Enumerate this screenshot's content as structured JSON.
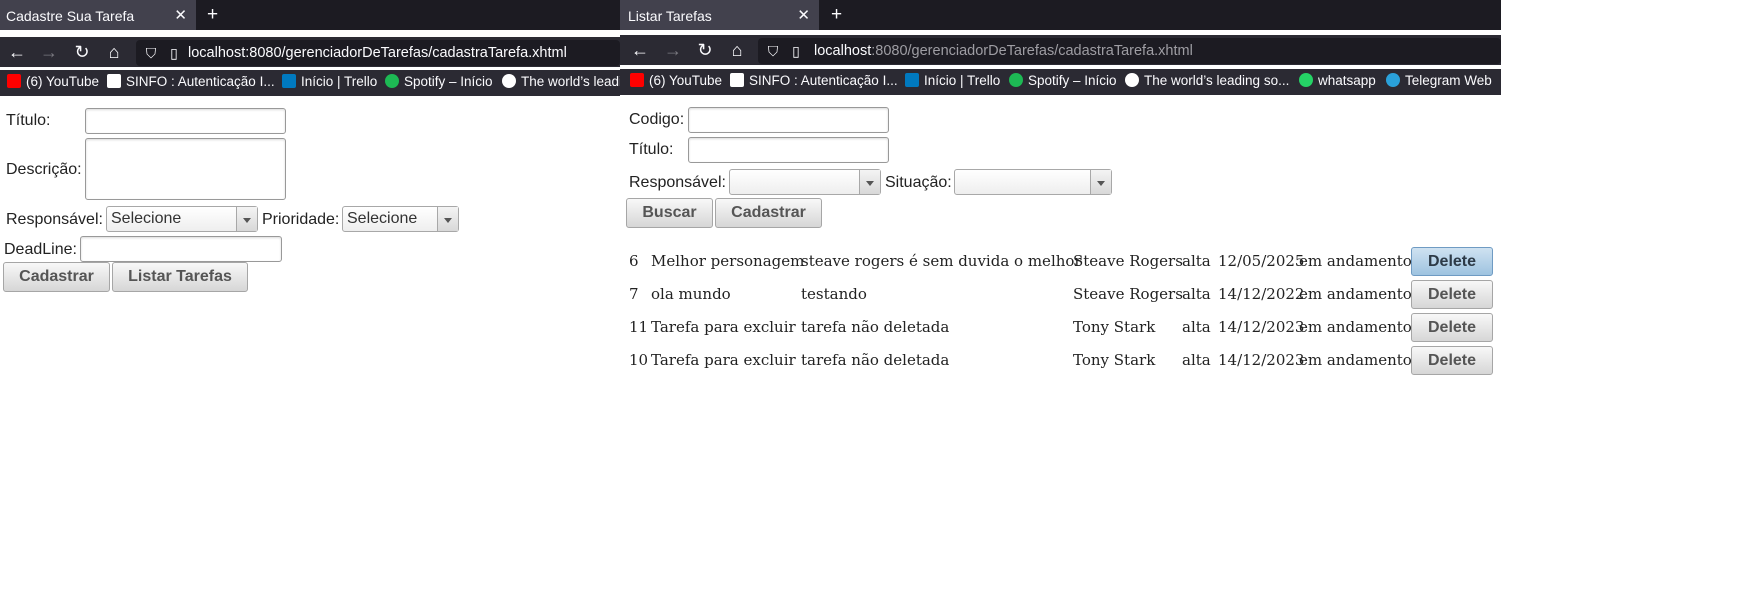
{
  "left_window": {
    "tab_title": "Cadastre Sua Tarefa",
    "url": "localhost:8080/gerenciadorDeTarefas/cadastraTarefa.xhtml",
    "form": {
      "titulo_label": "Título:",
      "descricao_label": "Descrição:",
      "responsavel_label": "Responsável:",
      "responsavel_value": "Selecione",
      "prioridade_label": "Prioridade:",
      "prioridade_value": "Selecione",
      "deadline_label": "DeadLine:",
      "cadastrar_button": "Cadastrar",
      "listar_button": "Listar Tarefas"
    }
  },
  "right_window": {
    "tab_title": "Listar Tarefas",
    "url_host": "localhost",
    "url_rest": ":8080/gerenciadorDeTarefas/cadastraTarefa.xhtml",
    "form": {
      "codigo_label": "Codigo:",
      "titulo_label": "Título:",
      "responsavel_label": "Responsável:",
      "situacao_label": "Situação:",
      "buscar_button": "Buscar",
      "cadastrar_button": "Cadastrar"
    },
    "delete_label": "Delete",
    "rows": [
      [
        "6",
        "Melhor personagem",
        "steave rogers é sem duvida o melhor",
        "Steave Rogers",
        "alta",
        "12/05/2025",
        "em andamento"
      ],
      [
        "7",
        "ola mundo",
        "testando",
        "Steave Rogers",
        "alta",
        "14/12/2022",
        "em andamento"
      ],
      [
        "11",
        "Tarefa para excluir",
        "tarefa não deletada",
        "Tony Stark",
        "alta",
        "14/12/2023",
        "em andamento"
      ],
      [
        "10",
        "Tarefa para excluir",
        "tarefa não deletada",
        "Tony Stark",
        "alta",
        "14/12/2023",
        "em andamento"
      ]
    ]
  },
  "bookmarks": [
    {
      "label": "(6) YouTube",
      "icon": "youtube-icon",
      "color": "#ff0000"
    },
    {
      "label": "SINFO : Autenticação I...",
      "icon": "sinfo-icon",
      "color": "#ffffff"
    },
    {
      "label": "Início | Trello",
      "icon": "trello-icon",
      "color": "#0079bf"
    },
    {
      "label": "Spotify – Início",
      "icon": "spotify-icon",
      "color": "#1db954"
    },
    {
      "label": "The world’s leading so...",
      "icon": "github-icon",
      "color": "#ffffff"
    },
    {
      "label": "whatsapp",
      "icon": "whatsapp-icon",
      "color": "#25d366"
    },
    {
      "label": "Telegram Web",
      "icon": "telegram-icon",
      "color": "#2aa1da"
    }
  ],
  "left_bookmarks_last_partial": "The world’s leadi"
}
